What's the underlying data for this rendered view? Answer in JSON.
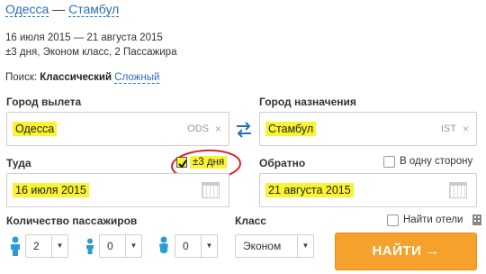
{
  "route": {
    "origin": "Одесса",
    "separator": "—",
    "destination": "Стамбул"
  },
  "summary": {
    "dates": "16 июля 2015 — 21 августа 2015",
    "details": "±3 дня, Эконом класс, 2 Пассажира"
  },
  "search_mode": {
    "label": "Поиск:",
    "current": "Классический",
    "alternative": "Сложный"
  },
  "origin": {
    "label": "Город вылета",
    "value": "Одесса",
    "code": "ODS",
    "clear": "×"
  },
  "destination": {
    "label": "Город назначения",
    "value": "Стамбул",
    "code": "IST",
    "clear": "×"
  },
  "depart": {
    "label": "Туда",
    "flex_label": "±3 дня",
    "flex_checked": true,
    "value": "16 июля 2015"
  },
  "return": {
    "label": "Обратно",
    "one_way_label": "В одну сторону",
    "one_way_checked": false,
    "value": "21 августа 2015"
  },
  "passengers": {
    "label": "Количество пассажиров",
    "adults": "2",
    "children": "0",
    "infants": "0"
  },
  "class": {
    "label": "Класс",
    "value": "Эконом"
  },
  "hotels": {
    "label": "Найти отели",
    "checked": false
  },
  "find_button": "НАЙТИ →",
  "colors": {
    "accent": "#f6a12b",
    "link": "#2a6fb5",
    "highlight": "#f8f431",
    "annotation": "#d9232a"
  }
}
